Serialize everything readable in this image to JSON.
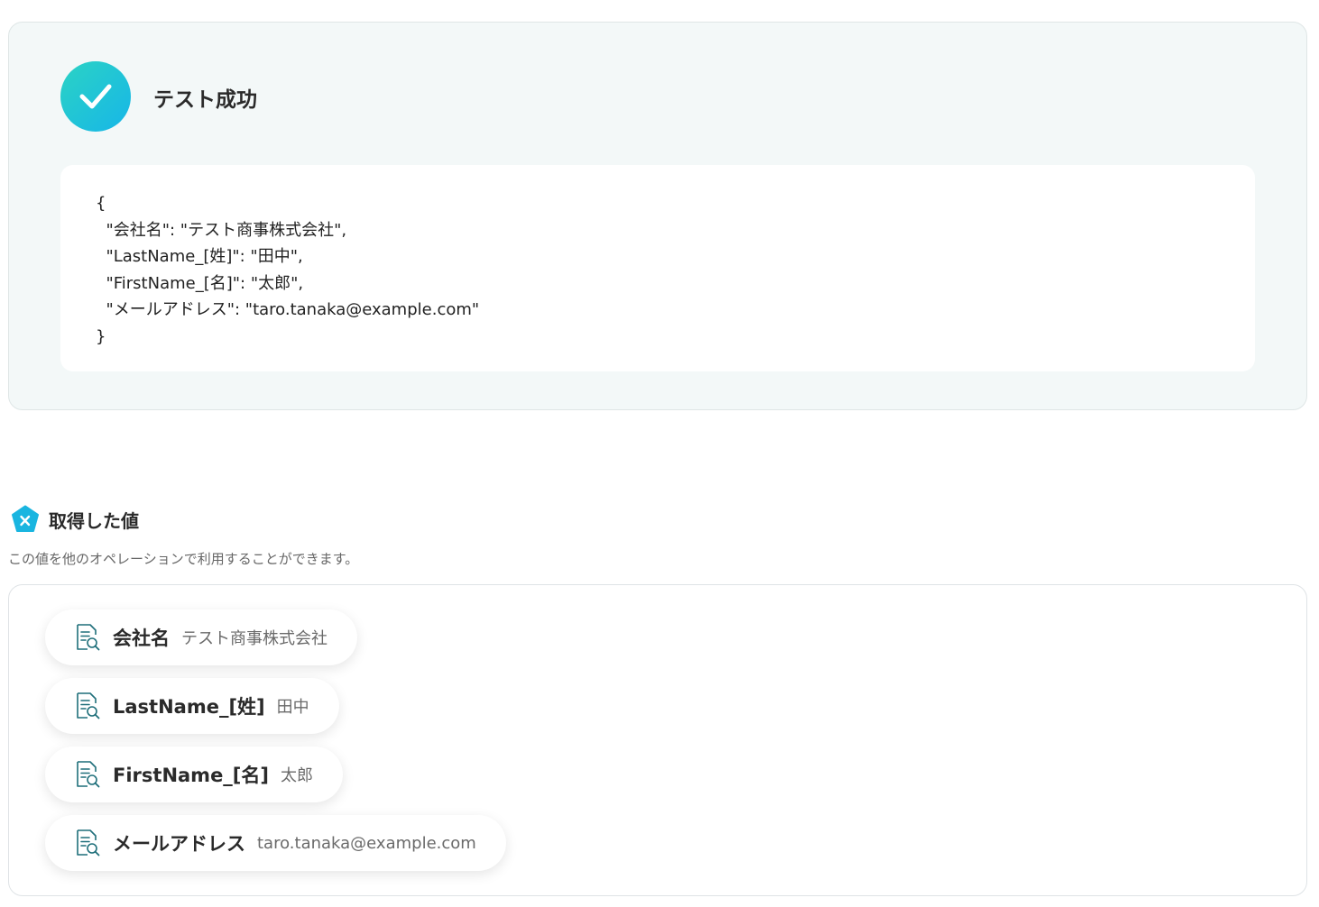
{
  "test_result": {
    "title": "テスト成功",
    "json_output": "{\n  \"会社名\": \"テスト商事株式会社\",\n  \"LastName_[姓]\": \"田中\",\n  \"FirstName_[名]\": \"太郎\",\n  \"メールアドレス\": \"taro.tanaka@example.com\"\n}",
    "icon": "check-circle-icon"
  },
  "retrieved_values": {
    "title": "取得した値",
    "description": "この値を他のオペレーションで利用することができます。",
    "icon": "variable-icon",
    "items": [
      {
        "name": "会社名",
        "value": "テスト商事株式会社",
        "icon": "document-search-icon"
      },
      {
        "name": "LastName_[姓]",
        "value": "田中",
        "icon": "document-search-icon"
      },
      {
        "name": "FirstName_[名]",
        "value": "太郎",
        "icon": "document-search-icon"
      },
      {
        "name": "メールアドレス",
        "value": "taro.tanaka@example.com",
        "icon": "document-search-icon"
      }
    ]
  },
  "colors": {
    "accent_gradient_start": "#2bd3c4",
    "accent_gradient_end": "#17b6e8",
    "icon_teal": "#1f6f7a",
    "card_background": "#f3f8f8"
  }
}
